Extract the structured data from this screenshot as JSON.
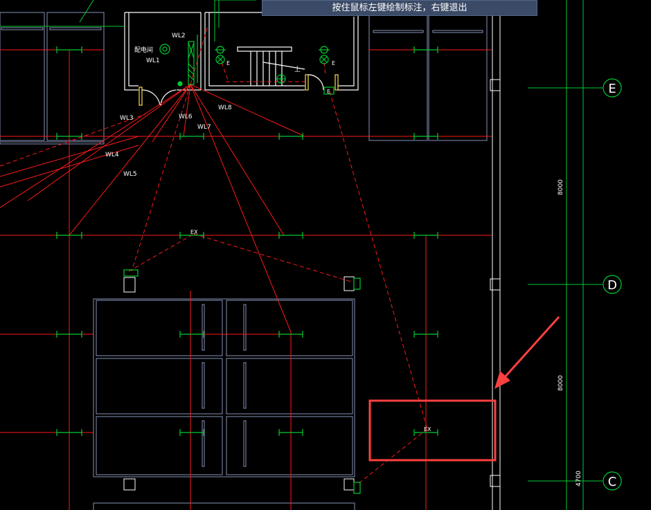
{
  "status_tip": "按住鼠标左键绘制标注，右键退出",
  "room_labels": {
    "dist_room": "配电间",
    "up_label": "上"
  },
  "circuit_labels": [
    "WL1",
    "WL2",
    "WL3",
    "WL4",
    "WL5",
    "WL6",
    "WL7",
    "WL8"
  ],
  "device_labels": {
    "ex1": "EX",
    "ex2": "EX",
    "e1": "E",
    "e2": "E",
    "e3": "E"
  },
  "axes": [
    {
      "label": "E",
      "dim": "8000"
    },
    {
      "label": "D",
      "dim": "8000"
    },
    {
      "label": "C",
      "dim": "4700"
    }
  ],
  "colors": {
    "background": "#000000",
    "wire": "#ff1a1a",
    "wall": "#ffffff",
    "structure": "#8893b8",
    "fixture": "#00cc33",
    "annotation": "#ff4040",
    "tip_bg": "#3b4a66"
  }
}
